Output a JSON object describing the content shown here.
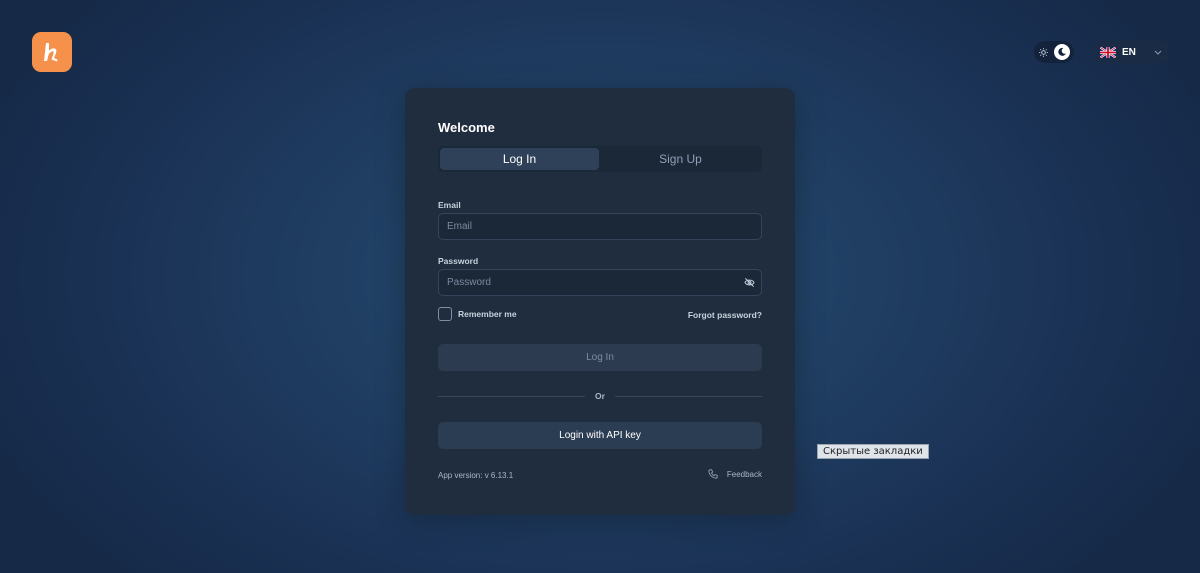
{
  "header": {
    "logo_icon": "brand-logo",
    "theme_toggle": {
      "light_icon": "sun-icon",
      "dark_icon": "moon-icon",
      "selected": "dark"
    },
    "language": {
      "flag_icon": "uk-flag-icon",
      "code": "EN"
    }
  },
  "auth": {
    "title": "Welcome",
    "tabs": [
      {
        "label": "Log In",
        "active": true
      },
      {
        "label": "Sign Up",
        "active": false
      }
    ],
    "email": {
      "label": "Email",
      "placeholder": "Email",
      "value": ""
    },
    "password": {
      "label": "Password",
      "placeholder": "Password",
      "value": ""
    },
    "remember_label": "Remember me",
    "forgot_label": "Forgot password?",
    "login_button": "Log In",
    "divider_text": "Or",
    "api_button": "Login with API key",
    "version": "App version: v 6.13.1",
    "feedback_label": "Feedback"
  },
  "tooltip": "Скрытые закладки",
  "colors": {
    "brand": "#f5914a",
    "card": "#1f2d3e",
    "background": "#1f3d61"
  }
}
